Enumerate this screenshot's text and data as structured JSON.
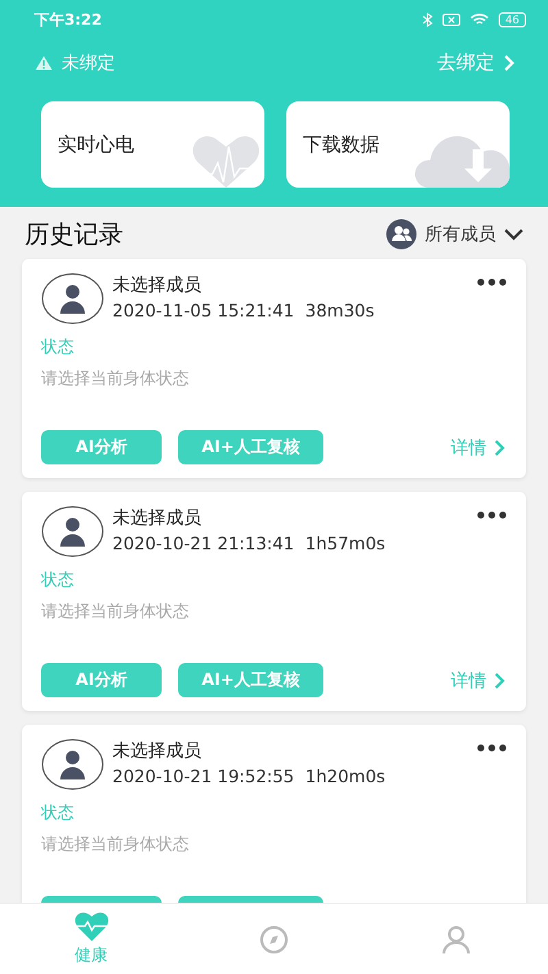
{
  "status_bar": {
    "time": "下午3:22",
    "battery": "46"
  },
  "binding": {
    "status": "未绑定",
    "action": "去绑定"
  },
  "shortcuts": [
    {
      "label": "实时心电",
      "kind": "ecg"
    },
    {
      "label": "下载数据",
      "kind": "download"
    }
  ],
  "history": {
    "title": "历史记录",
    "filter": "所有成员"
  },
  "records": [
    {
      "member": "未选择成员",
      "datetime": "2020-11-05 15:21:41",
      "duration": "38m30s",
      "status_label": "状态",
      "status_hint": "请选择当前身体状态",
      "buttons": [
        {
          "label": "AI分析",
          "kind": "analysis"
        },
        {
          "label": "AI+人工复核",
          "kind": "review"
        }
      ],
      "details": "详情"
    },
    {
      "member": "未选择成员",
      "datetime": "2020-10-21 21:13:41",
      "duration": "1h57m0s",
      "status_label": "状态",
      "status_hint": "请选择当前身体状态",
      "buttons": [
        {
          "label": "AI分析",
          "kind": "analysis"
        },
        {
          "label": "AI+人工复核",
          "kind": "review"
        }
      ],
      "details": "详情"
    },
    {
      "member": "未选择成员",
      "datetime": "2020-10-21 19:52:55",
      "duration": "1h20m0s",
      "status_label": "状态",
      "status_hint": "请选择当前身体状态",
      "buttons": [
        {
          "kind": "analysis"
        },
        {
          "kind": "review"
        }
      ]
    }
  ],
  "nav": [
    {
      "label": "健康",
      "kind": "health",
      "selected": true
    },
    {
      "kind": "discover",
      "selected": false
    },
    {
      "kind": "profile",
      "selected": false
    }
  ]
}
